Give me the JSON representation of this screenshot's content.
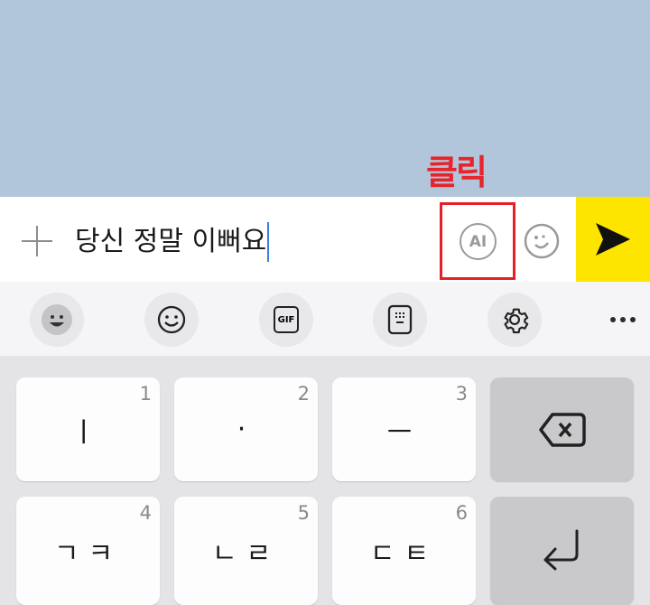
{
  "annotation": {
    "label": "클릭",
    "color": "#e8232b"
  },
  "input": {
    "value": "당신 정말 이뻐요",
    "ai_label": "AI"
  },
  "colors": {
    "chat_bg": "#b1c6da",
    "send_bg": "#fee500"
  },
  "toolbar": {
    "icons": [
      "emoticon-icon",
      "smiley-icon",
      "gif-icon",
      "keypad-icon",
      "gear-icon",
      "more-icon"
    ],
    "gif_label": "GIF"
  },
  "keys": [
    {
      "char": "ㅣ",
      "num": "1"
    },
    {
      "char": "·",
      "num": "2"
    },
    {
      "char": "ㅡ",
      "num": "3"
    },
    {
      "char": "ㄱㅋ",
      "num": "4"
    },
    {
      "char": "ㄴㄹ",
      "num": "5"
    },
    {
      "char": "ㄷㅌ",
      "num": "6"
    }
  ]
}
